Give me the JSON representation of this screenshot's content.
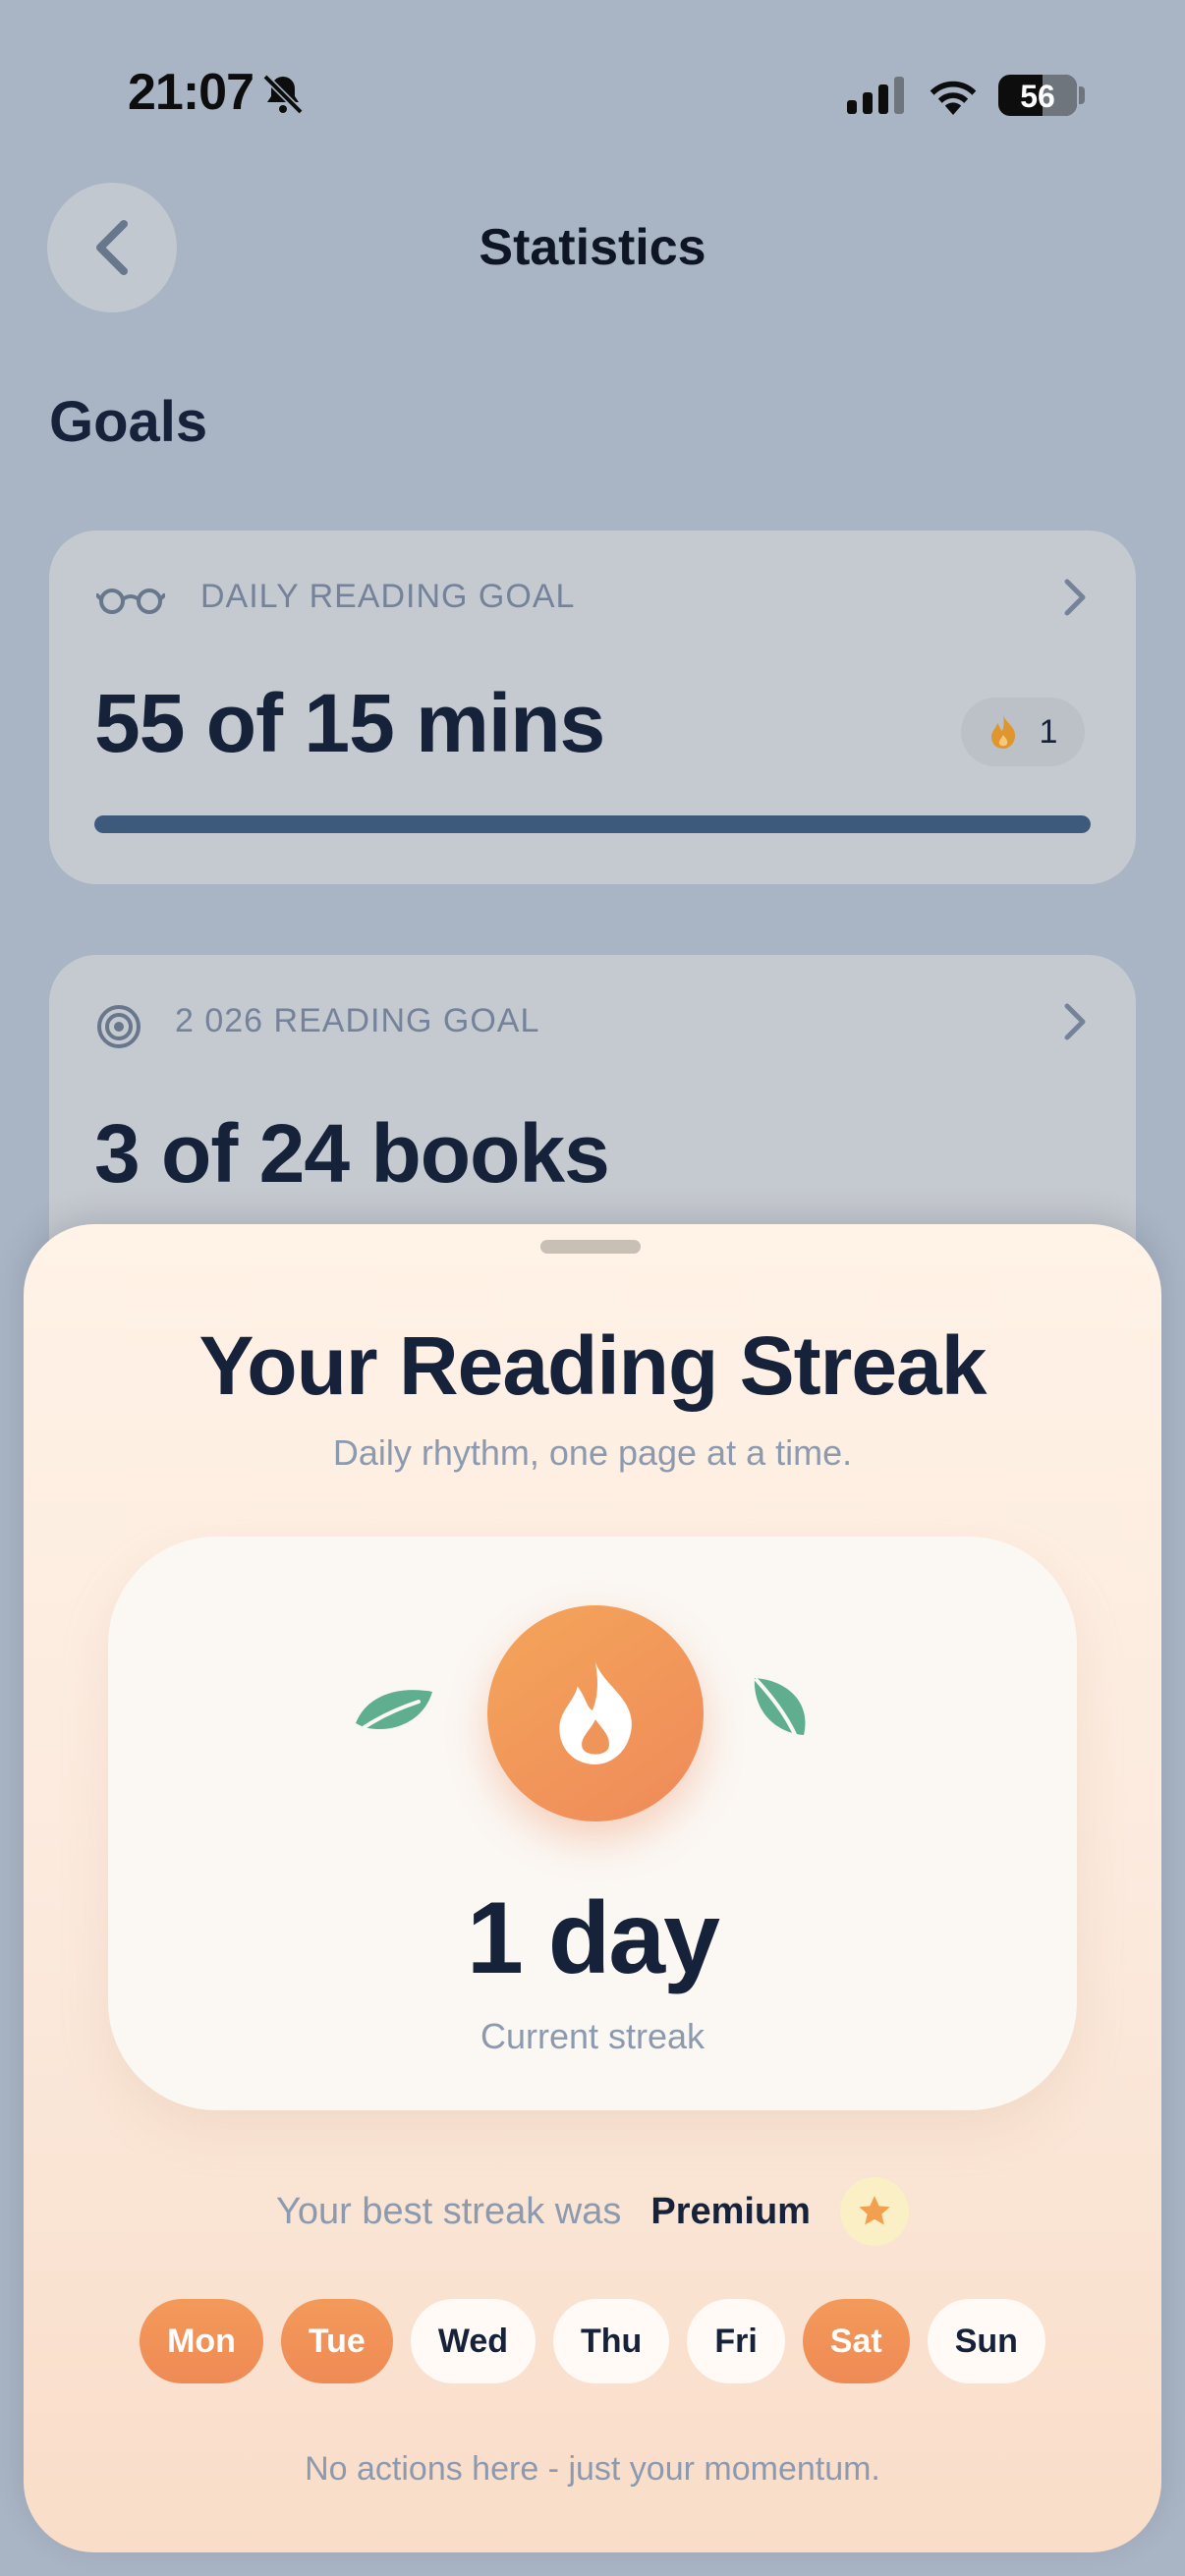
{
  "status_bar": {
    "time": "21:07",
    "battery_level": "56",
    "icons": [
      "bell-slash-icon",
      "signal-icon",
      "wifi-icon",
      "battery-icon"
    ]
  },
  "header": {
    "back_icon": "chevron-left-icon",
    "title": "Statistics"
  },
  "goals": {
    "section_title": "Goals",
    "daily": {
      "icon": "glasses-icon",
      "label": "DAILY READING GOAL",
      "value": "55 of 15 mins",
      "progress_fraction": 1.0,
      "streak_count": "1",
      "streak_icon": "flame-icon"
    },
    "yearly": {
      "icon": "target-icon",
      "label": "2 026 READING GOAL",
      "value": "3 of 24 books"
    }
  },
  "streak_sheet": {
    "title": "Your Reading Streak",
    "subtitle": "Daily rhythm, one page at a time.",
    "streak_value": "1 day",
    "streak_caption": "Current streak",
    "best_label": "Your best streak was",
    "best_value": "Premium",
    "days": [
      {
        "label": "Mon",
        "active": true
      },
      {
        "label": "Tue",
        "active": true
      },
      {
        "label": "Wed",
        "active": false
      },
      {
        "label": "Thu",
        "active": false
      },
      {
        "label": "Fri",
        "active": false
      },
      {
        "label": "Sat",
        "active": true
      },
      {
        "label": "Sun",
        "active": false
      }
    ],
    "footer": "No actions here - just your momentum."
  },
  "colors": {
    "accent_orange": "#ef8a5a",
    "progress": "#3d5a7d",
    "leaf_green": "#5fae8f",
    "text_dark": "#16213a"
  }
}
